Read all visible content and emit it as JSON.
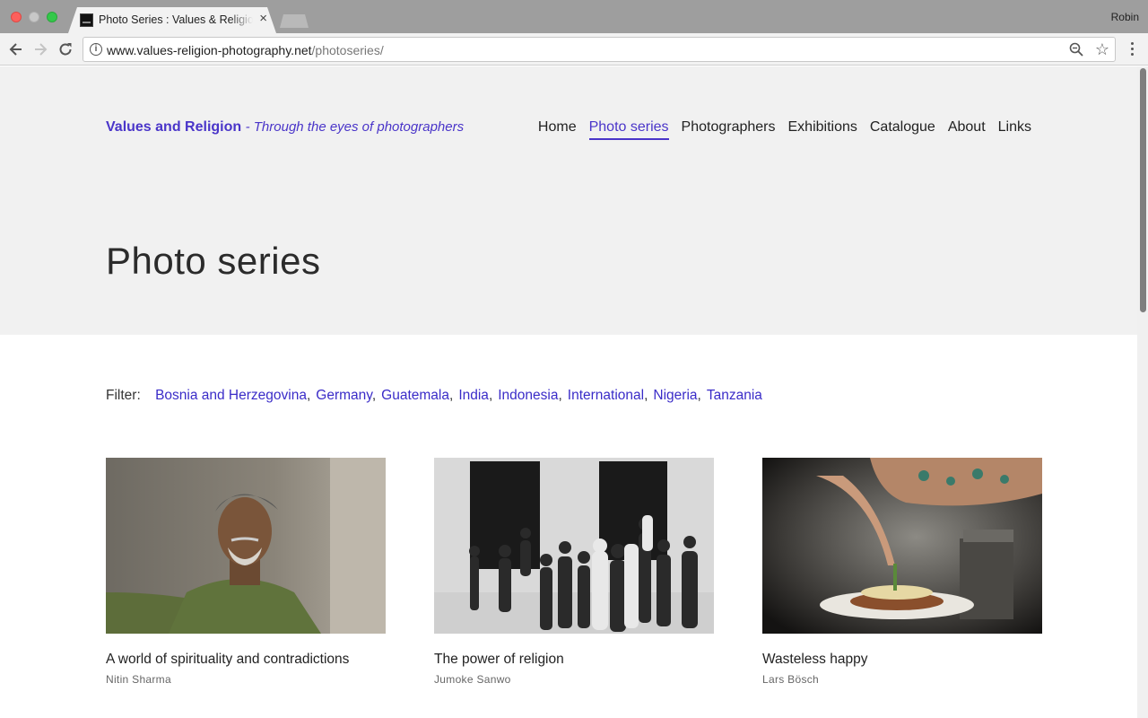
{
  "browser": {
    "tab_title": "Photo Series : Values & Religion",
    "tab_close": "×",
    "profile_name": "Robin",
    "url_host": "www.values-religion-photography.net",
    "url_path": "/photoseries/"
  },
  "site": {
    "brand_name": "Values and Religion",
    "brand_tagline": "- Through the eyes of photographers",
    "nav": [
      "Home",
      "Photo series",
      "Photographers",
      "Exhibitions",
      "Catalogue",
      "About",
      "Links"
    ],
    "nav_active": "Photo series"
  },
  "page": {
    "title": "Photo series",
    "filter_label": "Filter:",
    "filters": [
      "Bosnia and Herzegovina",
      "Germany",
      "Guatemala",
      "India",
      "Indonesia",
      "International",
      "Nigeria",
      "Tanzania"
    ],
    "cards": [
      {
        "title": "A world of spirituality and contradictions",
        "author": "Nitin Sharma"
      },
      {
        "title": "The power of religion",
        "author": "Jumoke Sanwo"
      },
      {
        "title": "Wasteless happy",
        "author": "Lars Bösch"
      }
    ]
  },
  "colors": {
    "accent": "#4a35c9",
    "hero_bg": "#f1f1f1"
  }
}
